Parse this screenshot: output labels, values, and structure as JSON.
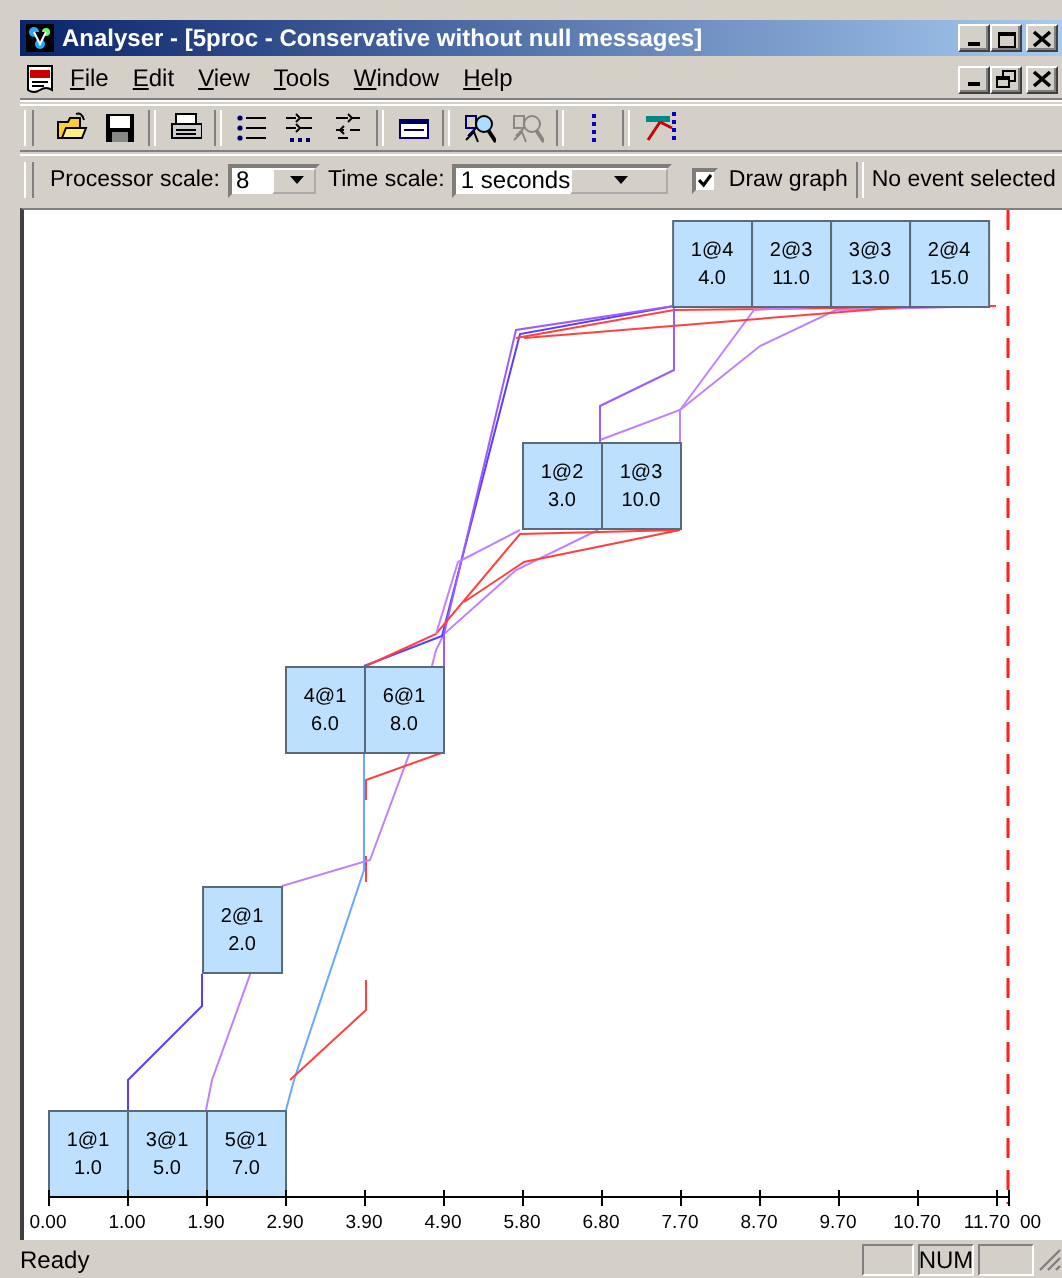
{
  "window": {
    "title": "Analyser - [5proc - Conservative without null messages]"
  },
  "menu": [
    "File",
    "Edit",
    "View",
    "Tools",
    "Window",
    "Help"
  ],
  "toolbar": [
    {
      "kind": "open",
      "disabled": false
    },
    {
      "kind": "save",
      "disabled": false
    },
    {
      "kind": "sep"
    },
    {
      "kind": "print",
      "disabled": false
    },
    {
      "kind": "sep"
    },
    {
      "kind": "list",
      "disabled": false
    },
    {
      "kind": "numbered",
      "disabled": false
    },
    {
      "kind": "swap",
      "disabled": false
    },
    {
      "kind": "sep"
    },
    {
      "kind": "window",
      "disabled": false
    },
    {
      "kind": "sep"
    },
    {
      "kind": "find",
      "disabled": false
    },
    {
      "kind": "find",
      "disabled": true
    },
    {
      "kind": "sep"
    },
    {
      "kind": "dotline",
      "disabled": false
    },
    {
      "kind": "sep"
    },
    {
      "kind": "graph",
      "disabled": false
    }
  ],
  "options": {
    "processor_scale": {
      "label": "Processor scale:",
      "value": "8"
    },
    "time_scale": {
      "label": "Time scale:",
      "value": "1 seconds"
    },
    "draw_graph": {
      "label": "Draw graph",
      "checked": true
    },
    "selection": "No event selected"
  },
  "graph": {
    "levels": [
      [
        {
          "label": "1@4",
          "time": "4.0"
        },
        {
          "label": "2@3",
          "time": "11.0"
        },
        {
          "label": "3@3",
          "time": "13.0"
        },
        {
          "label": "2@4",
          "time": "15.0"
        }
      ],
      [
        {
          "label": "1@2",
          "time": "3.0"
        },
        {
          "label": "1@3",
          "time": "10.0"
        }
      ],
      [
        {
          "label": "4@1",
          "time": "6.0"
        },
        {
          "label": "6@1",
          "time": "8.0"
        }
      ],
      [
        {
          "label": "2@1",
          "time": "2.0"
        }
      ],
      [
        {
          "label": "1@1",
          "time": "1.0"
        },
        {
          "label": "3@1",
          "time": "5.0"
        },
        {
          "label": "5@1",
          "time": "7.0"
        }
      ]
    ],
    "ticks": [
      "0.00",
      "1.00",
      "1.90",
      "2.90",
      "3.90",
      "4.90",
      "5.80",
      "6.80",
      "7.70",
      "8.70",
      "9.70",
      "10.70",
      "11.70"
    ],
    "end_label": "00"
  },
  "status_bar": {
    "text": "Ready",
    "indicator": "NUM"
  }
}
